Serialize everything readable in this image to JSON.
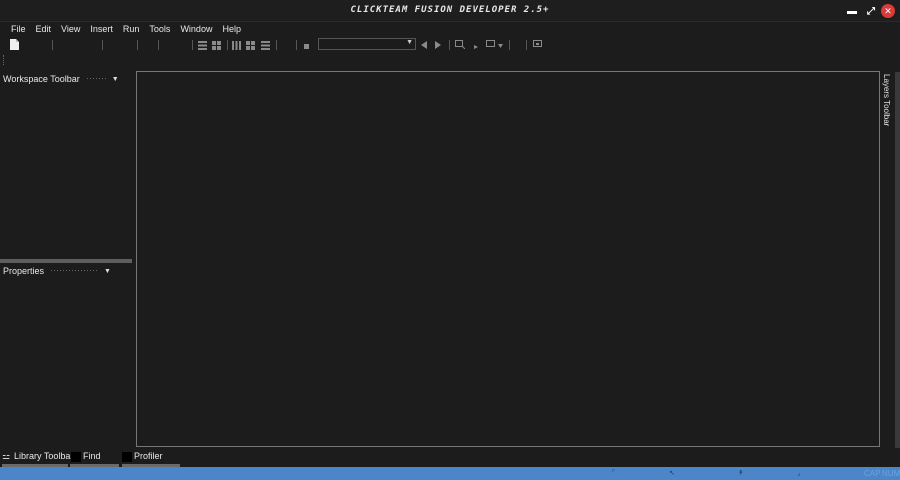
{
  "window": {
    "title": "CLICKTEAM FUSION DEVELOPER 2.5+"
  },
  "window_controls": {
    "minimize": "▬",
    "maximize": "⤢",
    "close": "✕"
  },
  "menu": [
    "File",
    "Edit",
    "View",
    "Insert",
    "Run",
    "Tools",
    "Window",
    "Help"
  ],
  "toolbar": {
    "frame_select_value": "",
    "icons": [
      "new-file-icon",
      "list-icon",
      "grid-icon",
      "align-icon",
      "nav-prev-icon",
      "nav-next-icon",
      "zoom-icon",
      "frame-icon"
    ]
  },
  "panels": {
    "workspace": {
      "title": "Workspace Toolbar"
    },
    "properties": {
      "title": "Properties"
    },
    "layers": {
      "title": "Layers Toolbar"
    }
  },
  "bottom_tabs": [
    "Library Toolbar",
    "Find",
    "Profiler"
  ],
  "status": {
    "cap": "CAP",
    "num": "NUM"
  },
  "colors": {
    "background": "#1c1c1c",
    "statusbar": "#4a86c8",
    "close": "#d93a3a",
    "editor_border": "#777777"
  }
}
